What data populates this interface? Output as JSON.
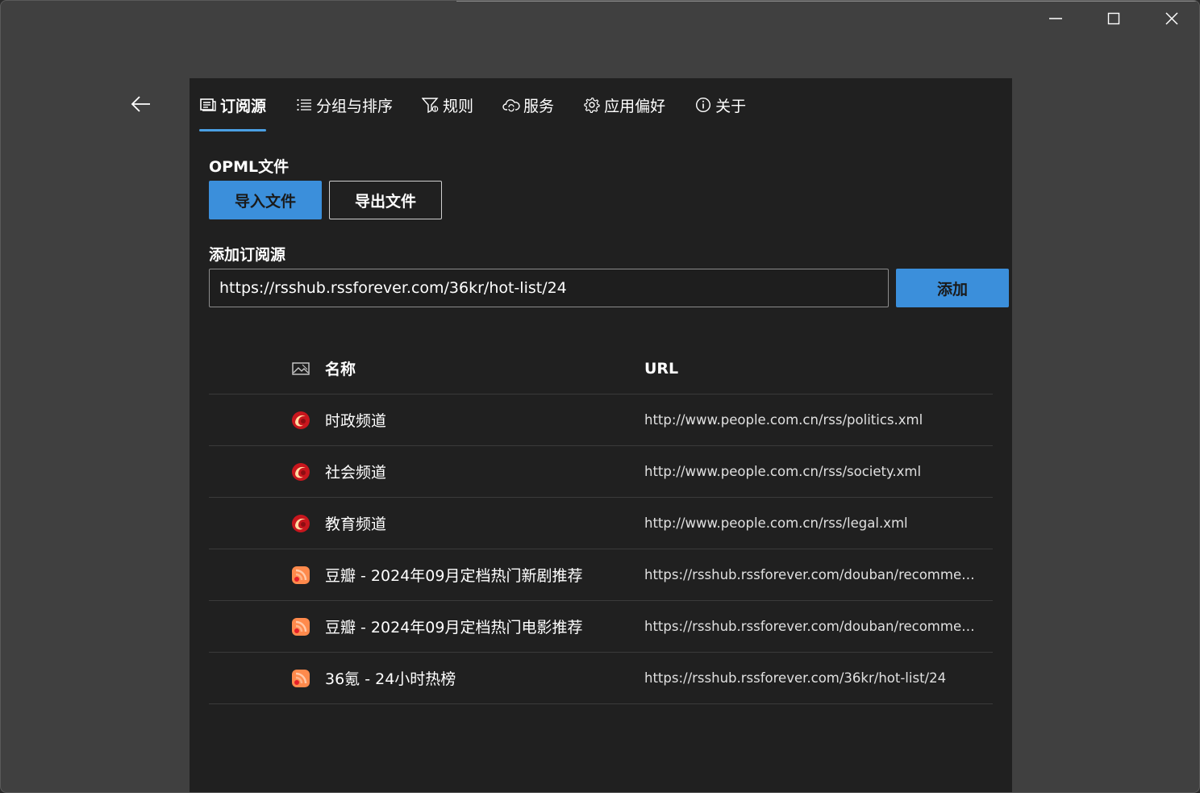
{
  "window": {
    "controls": {
      "minimize_icon": "minimize-icon",
      "maximize_icon": "maximize-icon",
      "close_icon": "close-icon"
    }
  },
  "nav": {
    "back_icon": "arrow-left-icon"
  },
  "tabs": [
    {
      "label": "订阅源",
      "icon": "feed-icon",
      "active": true
    },
    {
      "label": "分组与排序",
      "icon": "list-icon",
      "active": false
    },
    {
      "label": "规则",
      "icon": "filter-icon",
      "active": false
    },
    {
      "label": "服务",
      "icon": "cloud-sync-icon",
      "active": false
    },
    {
      "label": "应用偏好",
      "icon": "gear-icon",
      "active": false
    },
    {
      "label": "关于",
      "icon": "info-icon",
      "active": false
    }
  ],
  "opml": {
    "title": "OPML文件",
    "import_label": "导入文件",
    "export_label": "导出文件"
  },
  "add_source": {
    "title": "添加订阅源",
    "input_value": "https://rsshub.rssforever.com/36kr/hot-list/24",
    "add_label": "添加"
  },
  "table": {
    "header": {
      "icon": "image-icon",
      "name": "名称",
      "url": "URL"
    },
    "rows": [
      {
        "icon": "people-daily-icon",
        "name": "时政频道",
        "url": "http://www.people.com.cn/rss/politics.xml"
      },
      {
        "icon": "people-daily-icon",
        "name": "社会频道",
        "url": "http://www.people.com.cn/rss/society.xml"
      },
      {
        "icon": "people-daily-icon",
        "name": "教育频道",
        "url": "http://www.people.com.cn/rss/legal.xml"
      },
      {
        "icon": "rss-icon",
        "name": "豆瓣 - 2024年09月定档热门新剧推荐",
        "url": "https://rsshub.rssforever.com/douban/recommend..."
      },
      {
        "icon": "rss-icon",
        "name": "豆瓣 - 2024年09月定档热门电影推荐",
        "url": "https://rsshub.rssforever.com/douban/recommend..."
      },
      {
        "icon": "rss-icon",
        "name": "36氪 - 24小时热榜",
        "url": "https://rsshub.rssforever.com/36kr/hot-list/24"
      }
    ]
  },
  "colors": {
    "accent": "#3b8fdb",
    "panel_bg": "#202020",
    "window_bg": "#404040"
  }
}
